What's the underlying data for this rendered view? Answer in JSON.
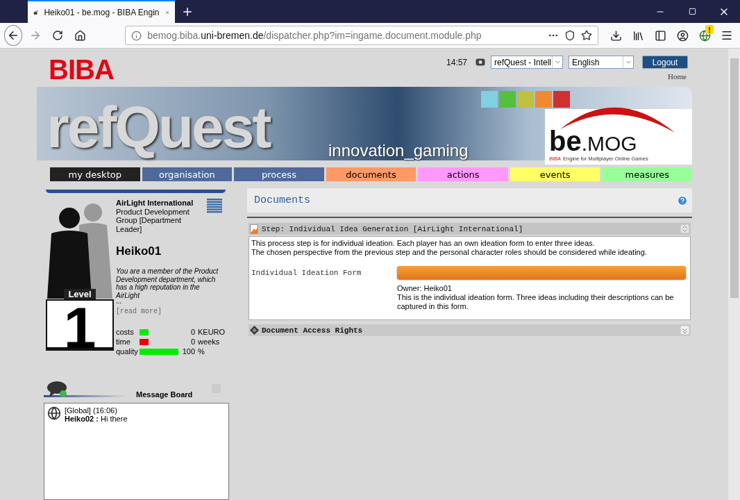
{
  "browser": {
    "tab_title": "Heiko01 - be.mog - BIBA Engin",
    "url_host": "bemog.biba.",
    "url_domain": "uni-bremen.de",
    "url_path": "/dispatcher.php?im=ingame.document.module.php",
    "notification": "!"
  },
  "header": {
    "logo": "BIBA",
    "time": "14:57",
    "game_select": "refQuest - Intell",
    "language_select": "English",
    "logout": "Logout",
    "home_link": "Home"
  },
  "banner": {
    "title": "refQuest",
    "subtitle": "innovation_gaming",
    "brand_main": "be",
    "brand_suffix": ".MOG",
    "tagline_brand": "BIBA",
    "tagline": "Engine for Multiplayer Online Games"
  },
  "nav": [
    {
      "label": "my desktop",
      "color": "#222222"
    },
    {
      "label": "organisation",
      "color": "#4f6a9a"
    },
    {
      "label": "process",
      "color": "#4f6a9a"
    },
    {
      "label": "documents",
      "color": "#ff9966"
    },
    {
      "label": "actions",
      "color": "#ff99ff"
    },
    {
      "label": "events",
      "color": "#ffff66"
    },
    {
      "label": "measures",
      "color": "#99ff99"
    }
  ],
  "profile": {
    "company": "AirLight International",
    "role": "Product Development Group [Department Leader]",
    "name": "Heiko01",
    "description": "You are a member of the Product Development department, which has a high reputation in the AirLight",
    "ellipsis": "...",
    "read_more": "[read more]",
    "level_label": "Level",
    "level_value": "1",
    "stats": [
      {
        "label": "costs",
        "color": "#00ee00",
        "level": 0.24,
        "value": "0",
        "unit": "KEURO"
      },
      {
        "label": "time",
        "color": "#ee0000",
        "level": 0.24,
        "value": "0",
        "unit": "weeks"
      },
      {
        "label": "quality",
        "color": "#00ee00",
        "level": 1,
        "value": "100",
        "unit": "%"
      }
    ]
  },
  "message_board": {
    "title": "Message Board",
    "messages": [
      {
        "channel": "[Global] (16:06)",
        "sender": "Heiko02 :",
        "text": "Hi there"
      }
    ]
  },
  "documents": {
    "title": "Documents",
    "panels": [
      {
        "kind": "step",
        "title": "Step: Individual Idea Generation [AirLight International]",
        "expanded": true,
        "description": [
          "This process step is for individual ideation. Each player has an own ideation form to enter three ideas.",
          "The chosen perspective from the previous step and the personal character roles should be considered while ideating."
        ],
        "forms": [
          {
            "label": "Individual Ideation Form",
            "owner": "Owner: Heiko01",
            "description": "This is the individual ideation form. Three ideas including their descriptions can be captured in this form."
          }
        ]
      },
      {
        "kind": "rights",
        "title": "Document Access Rights",
        "expanded": false
      }
    ]
  }
}
